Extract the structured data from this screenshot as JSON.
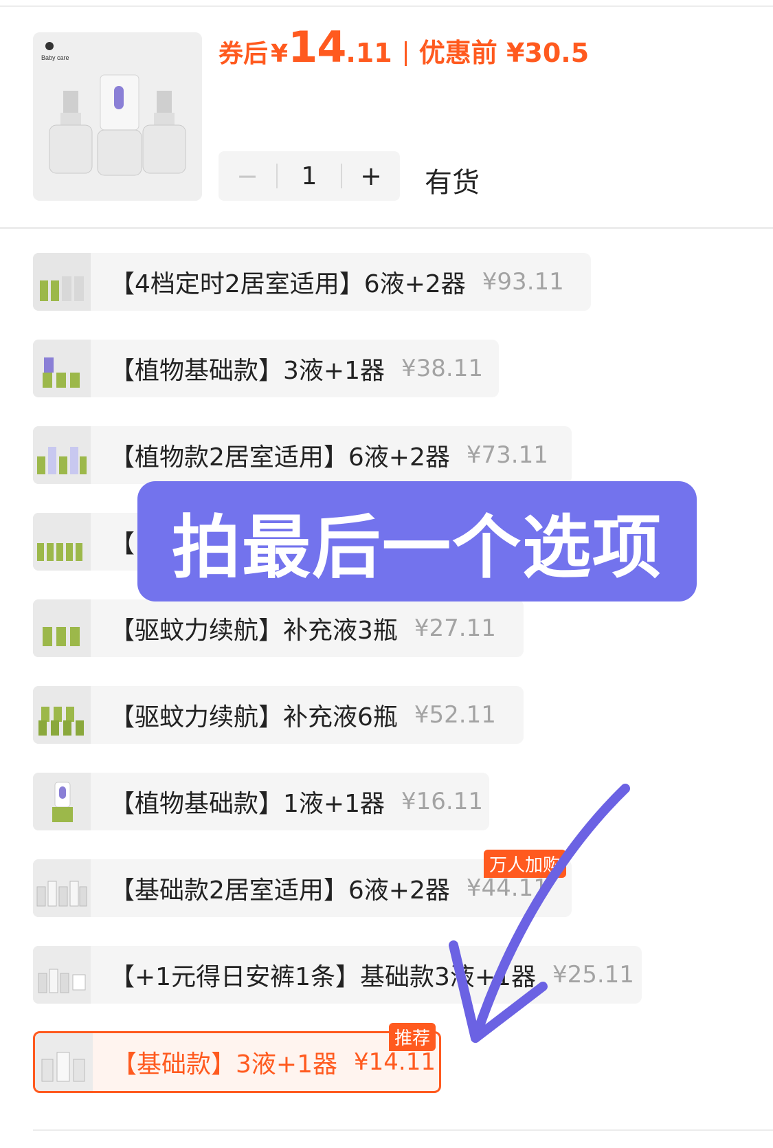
{
  "header": {
    "coupon_label": "券后",
    "currency": "¥",
    "price_int": "14",
    "price_dec": ".11",
    "before_label": "优惠前",
    "original_price": "¥30.5",
    "brand": "Baby care"
  },
  "quantity": {
    "minus": "−",
    "value": "1",
    "plus": "+"
  },
  "stock_status": "有货",
  "options": [
    {
      "label": "【4档定时2居室适用】6液+2器",
      "price": "¥93.11"
    },
    {
      "label": "【植物基础款】3液+1器",
      "price": "¥38.11"
    },
    {
      "label": "【植物款2居室适用】6液+2器",
      "price": "¥73.11"
    },
    {
      "label": "【",
      "price": ""
    },
    {
      "label": "【驱蚊力续航】补充液3瓶",
      "price": "¥27.11"
    },
    {
      "label": "【驱蚊力续航】补充液6瓶",
      "price": "¥52.11"
    },
    {
      "label": "【植物基础款】1液+1器",
      "price": "¥16.11"
    },
    {
      "label": "【基础款2居室适用】6液+2器",
      "price": "¥44.11",
      "badge": "万人加购"
    },
    {
      "label": "【+1元得日安裤1条】基础款3液+1器",
      "price": "¥25.11"
    },
    {
      "label": "【基础款】3液+1器",
      "price": "¥14.11",
      "badge": "推荐",
      "selected": true
    }
  ],
  "overlay_text": "拍最后一个选项",
  "colors": {
    "accent": "#ff5a1f",
    "overlay": "#6868ec",
    "price_gray": "#a3a3a3"
  }
}
